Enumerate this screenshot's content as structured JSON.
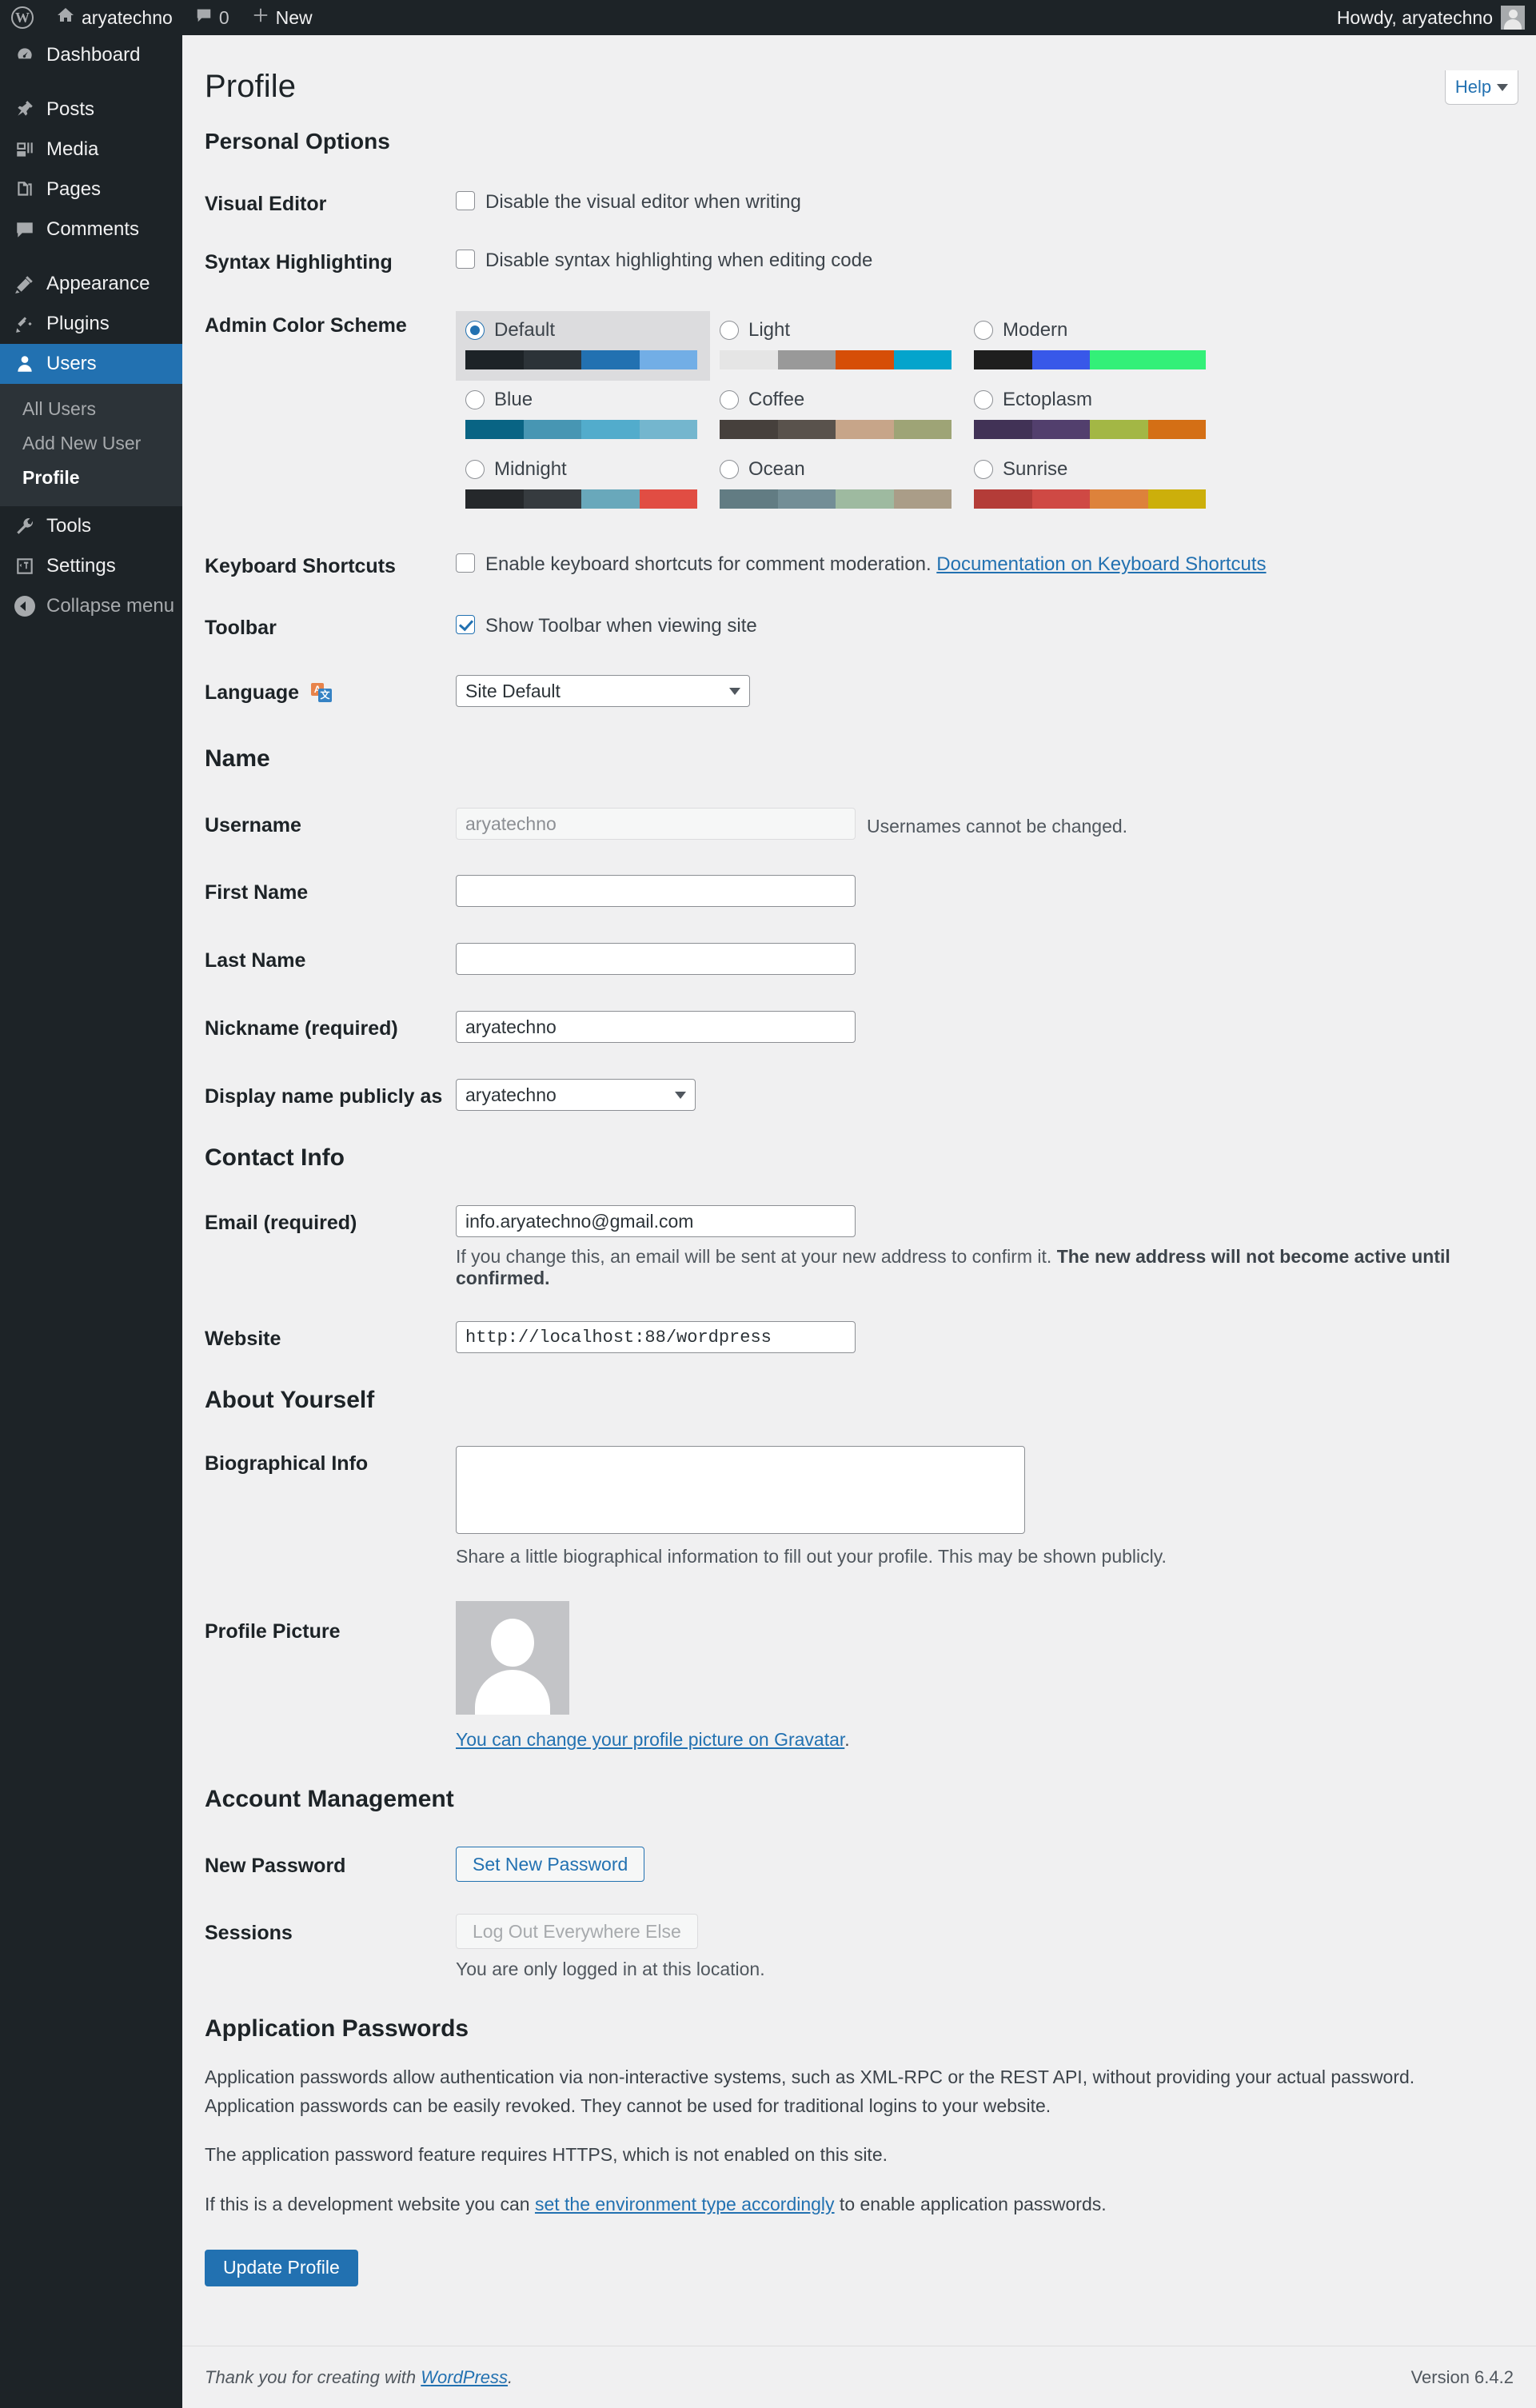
{
  "adminbar": {
    "logo_icon": "wordpress-logo-icon",
    "home_icon": "home-icon",
    "site_name": "aryatechno",
    "comments_icon": "comment-bubble-icon",
    "comments_count": "0",
    "new_icon": "plus-icon",
    "new_label": "New",
    "howdy": "Howdy, aryatechno",
    "avatar_icon": "user-avatar-icon"
  },
  "sidebar": {
    "items": [
      {
        "label": "Dashboard",
        "icon": "dashboard-icon"
      },
      {
        "label": "Posts",
        "icon": "pin-icon"
      },
      {
        "label": "Media",
        "icon": "media-icon"
      },
      {
        "label": "Pages",
        "icon": "pages-icon"
      },
      {
        "label": "Comments",
        "icon": "comments-icon"
      },
      {
        "label": "Appearance",
        "icon": "brush-icon"
      },
      {
        "label": "Plugins",
        "icon": "plugin-icon"
      },
      {
        "label": "Users",
        "icon": "users-icon"
      },
      {
        "label": "Tools",
        "icon": "wrench-icon"
      },
      {
        "label": "Settings",
        "icon": "settings-icon"
      },
      {
        "label": "Collapse menu",
        "icon": "collapse-icon"
      }
    ],
    "submenu": [
      {
        "label": "All Users"
      },
      {
        "label": "Add New User"
      },
      {
        "label": "Profile"
      }
    ]
  },
  "help": {
    "label": "Help",
    "icon": "chevron-down-icon"
  },
  "page": {
    "title": "Profile"
  },
  "personal_options": {
    "heading": "Personal Options",
    "visual_editor": {
      "label": "Visual Editor",
      "checkbox_label": "Disable the visual editor when writing",
      "checked": false
    },
    "syntax_highlighting": {
      "label": "Syntax Highlighting",
      "checkbox_label": "Disable syntax highlighting when editing code",
      "checked": false
    },
    "admin_color_scheme": {
      "label": "Admin Color Scheme",
      "selected": "Default",
      "schemes": [
        {
          "name": "Default",
          "colors": [
            "#1d2327",
            "#2c3338",
            "#2271b1",
            "#72aee6"
          ]
        },
        {
          "name": "Light",
          "colors": [
            "#e5e5e5",
            "#999999",
            "#d64e07",
            "#04a4cc"
          ]
        },
        {
          "name": "Modern",
          "colors": [
            "#1e1e1e",
            "#3858e9",
            "#33f078",
            "#33f078"
          ]
        },
        {
          "name": "Blue",
          "colors": [
            "#096484",
            "#4796b3",
            "#52accc",
            "#74b6ce"
          ]
        },
        {
          "name": "Coffee",
          "colors": [
            "#46403c",
            "#59524c",
            "#c7a589",
            "#9ea476"
          ]
        },
        {
          "name": "Ectoplasm",
          "colors": [
            "#413256",
            "#523f6d",
            "#a3b745",
            "#d46f15"
          ]
        },
        {
          "name": "Midnight",
          "colors": [
            "#25282b",
            "#363b3f",
            "#69a8bb",
            "#e14d43"
          ]
        },
        {
          "name": "Ocean",
          "colors": [
            "#627c83",
            "#738e96",
            "#9ebaa0",
            "#aa9d88"
          ]
        },
        {
          "name": "Sunrise",
          "colors": [
            "#b43c38",
            "#cf4944",
            "#dd823b",
            "#ccaf0b"
          ]
        }
      ]
    },
    "keyboard_shortcuts": {
      "label": "Keyboard Shortcuts",
      "checkbox_label": "Enable keyboard shortcuts for comment moderation.",
      "doc_link": "Documentation on Keyboard Shortcuts",
      "checked": false
    },
    "toolbar": {
      "label": "Toolbar",
      "checkbox_label": "Show Toolbar when viewing site",
      "checked": true
    },
    "language": {
      "label": "Language",
      "icon": "translate-icon",
      "value": "Site Default"
    }
  },
  "name_section": {
    "heading": "Name",
    "username": {
      "label": "Username",
      "value": "aryatechno",
      "note": "Usernames cannot be changed."
    },
    "first_name": {
      "label": "First Name",
      "value": ""
    },
    "last_name": {
      "label": "Last Name",
      "value": ""
    },
    "nickname": {
      "label": "Nickname (required)",
      "value": "aryatechno"
    },
    "display_name": {
      "label": "Display name publicly as",
      "value": "aryatechno"
    }
  },
  "contact_info": {
    "heading": "Contact Info",
    "email": {
      "label": "Email (required)",
      "value": "info.aryatechno@gmail.com",
      "note_normal": "If you change this, an email will be sent at your new address to confirm it. ",
      "note_strong": "The new address will not become active until confirmed."
    },
    "website": {
      "label": "Website",
      "value": "http://localhost:88/wordpress"
    }
  },
  "about_yourself": {
    "heading": "About Yourself",
    "bio": {
      "label": "Biographical Info",
      "value": "",
      "note": "Share a little biographical information to fill out your profile. This may be shown publicly."
    },
    "profile_picture": {
      "label": "Profile Picture",
      "avatar_icon": "default-avatar-icon",
      "link_text": "You can change your profile picture on Gravatar",
      "link_suffix": "."
    }
  },
  "account_management": {
    "heading": "Account Management",
    "new_password": {
      "label": "New Password",
      "button": "Set New Password"
    },
    "sessions": {
      "label": "Sessions",
      "button": "Log Out Everywhere Else",
      "disabled": true,
      "note": "You are only logged in at this location."
    }
  },
  "application_passwords": {
    "heading": "Application Passwords",
    "p1": "Application passwords allow authentication via non-interactive systems, such as XML-RPC or the REST API, without providing your actual password. Application passwords can be easily revoked. They cannot be used for traditional logins to your website.",
    "p2": "The application password feature requires HTTPS, which is not enabled on this site.",
    "p3_before": "If this is a development website you can ",
    "p3_link": "set the environment type accordingly",
    "p3_after": " to enable application passwords."
  },
  "submit": {
    "label": "Update Profile"
  },
  "footer": {
    "thanks_before": "Thank you for creating with ",
    "thanks_link": "WordPress",
    "thanks_after": ".",
    "version": "Version 6.4.2"
  },
  "colors": {
    "accent": "#2271b1",
    "sidebar_bg": "#1d2327",
    "submenu_bg": "#2c3338",
    "page_bg": "#f0f0f1"
  }
}
